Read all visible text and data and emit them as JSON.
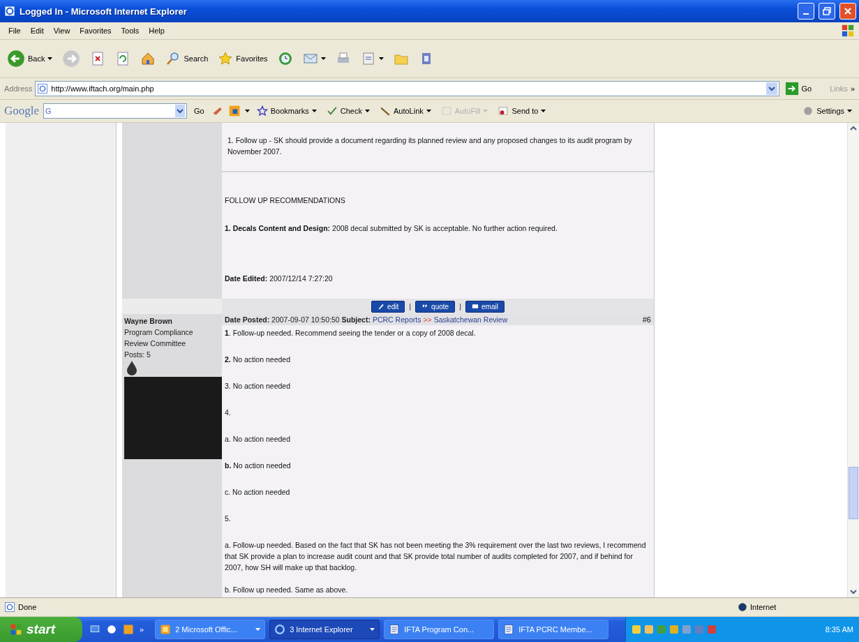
{
  "window": {
    "title": "Logged In - Microsoft Internet Explorer"
  },
  "menu": [
    "File",
    "Edit",
    "View",
    "Favorites",
    "Tools",
    "Help"
  ],
  "toolbar": [
    {
      "kind": "back",
      "label": "Back",
      "dropdown": true
    },
    {
      "kind": "forward",
      "dropdown": false
    },
    {
      "kind": "stop",
      "dropdown": false
    },
    {
      "kind": "refresh",
      "dropdown": false
    },
    {
      "kind": "home",
      "dropdown": false
    },
    {
      "kind": "search",
      "label": "Search",
      "dropdown": false
    },
    {
      "kind": "favorites",
      "label": "Favorites",
      "dropdown": false
    },
    {
      "kind": "history",
      "dropdown": false
    },
    {
      "kind": "mail",
      "dropdown": true
    },
    {
      "kind": "print",
      "dropdown": false
    },
    {
      "kind": "edit",
      "dropdown": true
    },
    {
      "kind": "folder",
      "dropdown": false
    },
    {
      "kind": "tool",
      "dropdown": false
    }
  ],
  "address": {
    "label": "Address",
    "value": "http://www.iftach.org/main.php",
    "go": "Go",
    "links": "Links",
    "more": "»"
  },
  "google_bar": {
    "logo": "Google",
    "search_prefix": "G",
    "go": "Go",
    "items": [
      {
        "kind": "bookmarks",
        "label": "Bookmarks",
        "disabled": false
      },
      {
        "kind": "check",
        "label": "Check",
        "disabled": false
      },
      {
        "kind": "autolink",
        "label": "AutoLink",
        "disabled": false
      },
      {
        "kind": "autofill",
        "label": "AutoFill",
        "disabled": true
      },
      {
        "kind": "sendto",
        "label": "Send to",
        "disabled": false
      }
    ],
    "settings": "Settings"
  },
  "previous_post": {
    "paragraphs": [
      "1.  Follow up - SK should provide a document regarding its planned review and any proposed changes to its audit program by November 2007."
    ],
    "heading": "FOLLOW UP RECOMMENDATIONS",
    "recommendation": "**1. Decals Content and Design:**  2008 decal submitted by SK is acceptable.  No further action required.",
    "edited": "**Date Edited:** 2007/12/14 7:27:20"
  },
  "post_actions": [
    {
      "kind": "edit",
      "label": "edit"
    },
    {
      "kind": "quote",
      "label": "quote"
    },
    {
      "kind": "email",
      "label": "email"
    }
  ],
  "action_separators": [
    "|",
    "|"
  ],
  "post": {
    "author": "Wayne Brown",
    "role": [
      "Program Compliance",
      "Review Committee"
    ],
    "posts": "Posts: 5",
    "header": "**Date Posted:** 2007-09-07 10:50:50 **Subject:**",
    "subject": [
      {
        "kind": "link",
        "text": "PCRC Reports"
      },
      {
        "kind": "separator",
        "text": ">>"
      },
      {
        "kind": "link",
        "text": "Saskatchewan Review"
      }
    ],
    "number": "#6",
    "body": [
      "**1**. Follow-up needed.  Recommend seeing the tender or a copy of 2008 decal.",
      "**2.** No action needed",
      "3. No action needed",
      "4.",
      "a. No action needed",
      "**b.** No action needed",
      "c. No action needed",
      "5.",
      "a. Follow-up needed.  Based on the fact that SK has not been meeting the 3% requirement over the last two reviews, I recommend that SK provide a plan to increase audit count and that SK provide total number of audits completed for 2007, and if behind for 2007, how SH will make up that backlog.",
      "b. Follow up needed.  Same as above."
    ]
  },
  "status": {
    "text": "Done",
    "zone": "Internet"
  },
  "taskbar": {
    "start": "start",
    "more": "»",
    "tasks": [
      {
        "kind": "office",
        "label": "2 Microsoft Offic...",
        "selected": false,
        "dropdown": true
      },
      {
        "kind": "browser",
        "label": "3 Internet Explorer",
        "selected": true,
        "dropdown": true
      },
      {
        "kind": "document",
        "label": "IFTA Program Con...",
        "selected": false,
        "dropdown": false
      },
      {
        "kind": "document",
        "label": "IFTA PCRC Membe...",
        "selected": false,
        "dropdown": false
      }
    ],
    "clock": "8:35 AM"
  }
}
